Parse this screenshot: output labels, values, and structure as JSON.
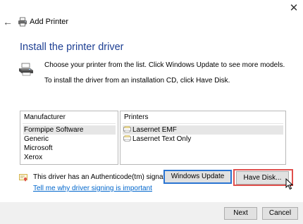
{
  "window": {
    "title": "Add Printer",
    "close_glyph": "✕",
    "back_glyph": "←"
  },
  "heading": "Install the printer driver",
  "instructions": {
    "line1": "Choose your printer from the list. Click Windows Update to see more models.",
    "line2": "To install the driver from an installation CD, click Have Disk."
  },
  "manufacturer_list": {
    "header": "Manufacturer",
    "items": [
      {
        "label": "Formpipe Software",
        "selected": true
      },
      {
        "label": "Generic",
        "selected": false
      },
      {
        "label": "Microsoft",
        "selected": false
      },
      {
        "label": "Xerox",
        "selected": false
      }
    ]
  },
  "printers_list": {
    "header": "Printers",
    "items": [
      {
        "label": "Lasernet EMF",
        "selected": true,
        "icon": "printer-icon"
      },
      {
        "label": "Lasernet Text Only",
        "selected": false,
        "icon": "printer-icon"
      }
    ]
  },
  "signature": {
    "text": "This driver has an Authenticode(tm) signature.",
    "link": "Tell me why driver signing is important",
    "icon": "certificate-icon"
  },
  "buttons": {
    "windows_update": "Windows Update",
    "have_disk": "Have Disk...",
    "next": "Next",
    "cancel": "Cancel"
  },
  "colors": {
    "heading": "#1d3f93",
    "link": "#0066cc",
    "focus_border": "#2a74d2",
    "highlight_box": "#e0504d",
    "footer_bg": "#f0f0f0"
  }
}
